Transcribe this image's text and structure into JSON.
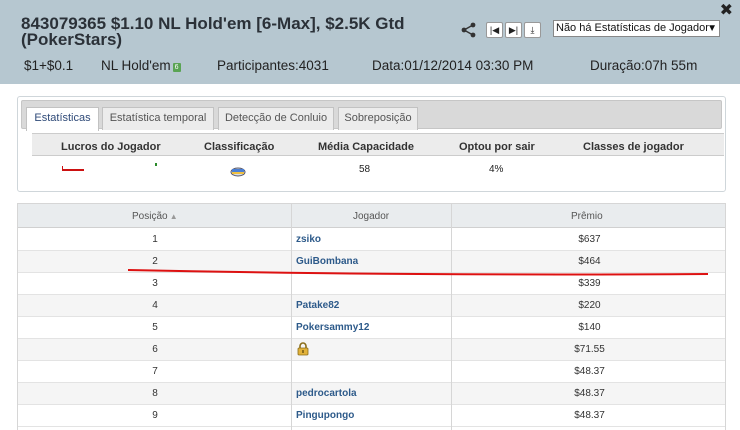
{
  "header": {
    "title": "843079365 $1.10 NL Hold'em [6-Max], $2.5K Gtd (PokerStars)",
    "close_glyph": "✖",
    "stats_select": "Não há Estatísticas de Jogador",
    "buyin": "$1+$0.1",
    "game": "NL Hold'em",
    "game_badge": "6",
    "participants": "Participantes:4031",
    "date": "Data:01/12/2014 03:30 PM",
    "duration": "Duração:07h 55m",
    "icons": [
      "share-icon",
      "skip-first-icon",
      "skip-last-icon",
      "download-icon"
    ]
  },
  "tabs": [
    "Estatísticas",
    "Estatística temporal",
    "Detecção de Conluio",
    "Sobreposição"
  ],
  "stats": {
    "headers": [
      "Lucros do Jogador",
      "Classificação",
      "Média Capacidade",
      "Optou por sair",
      "Classes de jogador"
    ],
    "media_capacidade": "58",
    "optou_por_sair": "4%"
  },
  "table": {
    "headers": [
      "Posição",
      "Jogador",
      "Prêmio"
    ],
    "rows": [
      {
        "pos": "1",
        "player": "zsiko",
        "prize": "$637"
      },
      {
        "pos": "2",
        "player": "GuiBombana",
        "prize": "$464"
      },
      {
        "pos": "3",
        "player": "",
        "prize": "$339"
      },
      {
        "pos": "4",
        "player": "Patake82",
        "prize": "$220"
      },
      {
        "pos": "5",
        "player": "Pokersammy12",
        "prize": "$140"
      },
      {
        "pos": "6",
        "player": "",
        "prize": "$71.55"
      },
      {
        "pos": "7",
        "player": "",
        "prize": "$48.37"
      },
      {
        "pos": "8",
        "player": "pedrocartola",
        "prize": "$48.37"
      },
      {
        "pos": "9",
        "player": "Pingupongo",
        "prize": "$48.37"
      }
    ]
  },
  "colors": {
    "header_bg": "#b6c7d0",
    "link": "#2d5a8a",
    "annotation_red": "#dd1111"
  }
}
